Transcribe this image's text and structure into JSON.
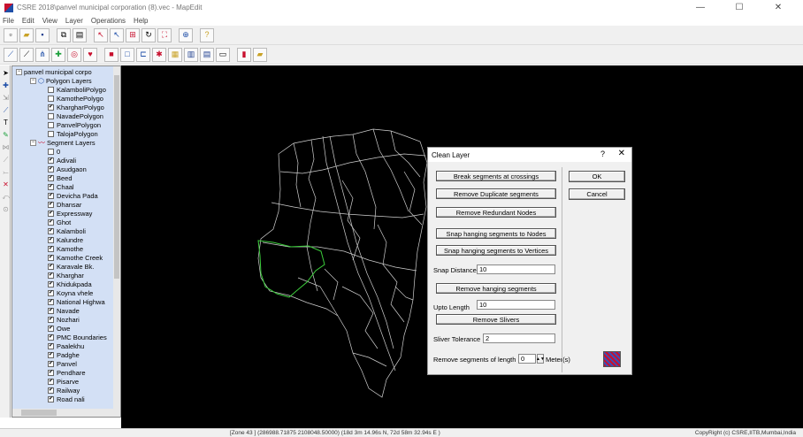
{
  "window": {
    "title": "CSRE 2018\\panvel municipal corporation (8).vec - MapEdit",
    "controls": [
      "—",
      "☐",
      "✕"
    ]
  },
  "menu": [
    "File",
    "Edit",
    "View",
    "Layer",
    "Operations",
    "Help"
  ],
  "layer_panel": {
    "root_label": "panvel municipal corpo",
    "polygon_group": "Polygon Layers",
    "polygon_layers": [
      {
        "name": "KalamboliPolygo",
        "checked": false
      },
      {
        "name": "KamothePolygo",
        "checked": false
      },
      {
        "name": "KhargharPolygo",
        "checked": true
      },
      {
        "name": "NavadePolygon",
        "checked": false
      },
      {
        "name": "PanvelPolygon",
        "checked": false
      },
      {
        "name": "TalojaPolygon",
        "checked": false
      }
    ],
    "segment_group": "Segment Layers",
    "segment_layers": [
      {
        "name": "0",
        "checked": false
      },
      {
        "name": "Adivali",
        "checked": true
      },
      {
        "name": "Asudgaon",
        "checked": true
      },
      {
        "name": "Beed",
        "checked": true
      },
      {
        "name": "Chaal",
        "checked": true
      },
      {
        "name": "Devicha Pada",
        "checked": true
      },
      {
        "name": "Dhansar",
        "checked": true
      },
      {
        "name": "Expressway",
        "checked": true
      },
      {
        "name": "Ghot",
        "checked": true
      },
      {
        "name": "Kalamboli",
        "checked": true
      },
      {
        "name": "Kalundre",
        "checked": true
      },
      {
        "name": "Kamothe",
        "checked": true
      },
      {
        "name": "Kamothe Creek",
        "checked": true
      },
      {
        "name": "Karavale Bk.",
        "checked": true
      },
      {
        "name": "Kharghar",
        "checked": true
      },
      {
        "name": "Khidukpada",
        "checked": true
      },
      {
        "name": "Koyna vhele",
        "checked": true
      },
      {
        "name": "National Highwa",
        "checked": true
      },
      {
        "name": "Navade",
        "checked": true
      },
      {
        "name": "Nozhari",
        "checked": true
      },
      {
        "name": "Owe",
        "checked": true
      },
      {
        "name": "PMC Boundaries",
        "checked": true
      },
      {
        "name": "Paalekhu",
        "checked": true
      },
      {
        "name": "Padghe",
        "checked": true
      },
      {
        "name": "Panvel",
        "checked": true
      },
      {
        "name": "Pendhare",
        "checked": true
      },
      {
        "name": "Pisarve",
        "checked": true
      },
      {
        "name": "Railway",
        "checked": true
      },
      {
        "name": "Road nali",
        "checked": true
      }
    ]
  },
  "dialog": {
    "title": "Clean Layer",
    "help": "?",
    "close": "✕",
    "buttons": {
      "break_segments": "Break segments at crossings",
      "remove_duplicate": "Remove Duplicate segments",
      "remove_redundant": "Remove Redundant Nodes",
      "snap_nodes": "Snap hanging segments to Nodes",
      "snap_vertices": "Snap hanging segments to Vertices",
      "remove_hanging": "Remove hanging segments",
      "remove_slivers": "Remove Slivers",
      "ok": "OK",
      "cancel": "Cancel"
    },
    "snap_distance_label": "Snap Distance",
    "snap_distance_value": "10",
    "upto_length_label": "Upto Length",
    "upto_length_value": "10",
    "sliver_tolerance_label": "Sliver Tolerance",
    "sliver_tolerance_value": "2",
    "remove_length_label": "Remove segments of length",
    "remove_length_value": "0",
    "remove_length_unit": "Meter(s)"
  },
  "statusbar": {
    "coords": "[Zone 43 ] (286988.71875 2108048.50000) (18d 3m 14.96s N, 72d 58m 32.94s E )",
    "copyright": "CopyRight (c) CSRE,IITB,Mumbai,India"
  },
  "colors": {
    "map_background": "#000000",
    "segment_lines": "#cfcfcf",
    "selected_polygon": "#3ccf3c",
    "layer_panel_bg": "#d3e0f5"
  }
}
